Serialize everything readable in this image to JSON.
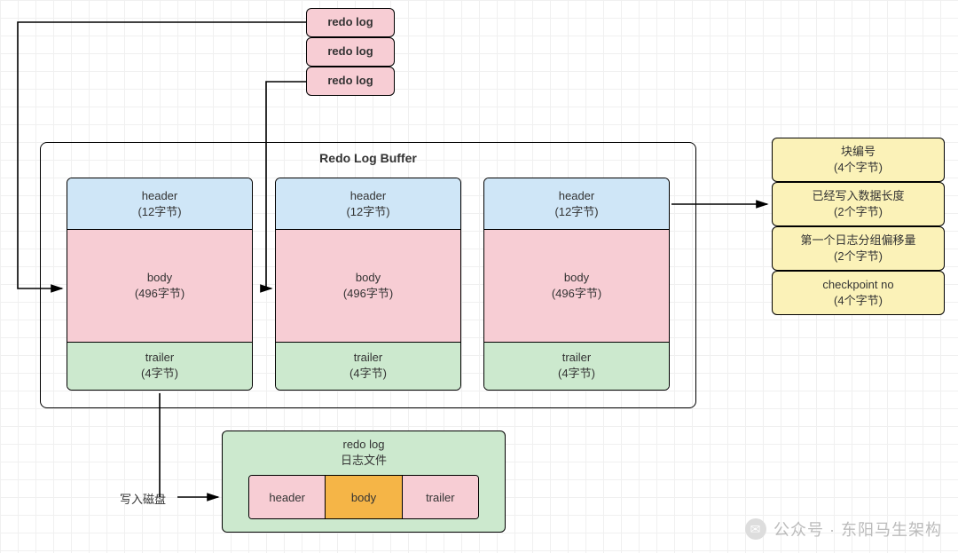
{
  "redoTop": [
    "redo log",
    "redo log",
    "redo log"
  ],
  "mainTitle": "Redo Log Buffer",
  "block": {
    "header": {
      "label": "header",
      "size": "(12字节)"
    },
    "body": {
      "label": "body",
      "size": "(496字节)"
    },
    "trailer": {
      "label": "trailer",
      "size": "(4字节)"
    }
  },
  "yellow": [
    {
      "l1": "块编号",
      "l2": "(4个字节)"
    },
    {
      "l1": "已经写入数据长度",
      "l2": "(2个字节)"
    },
    {
      "l1": "第一个日志分组偏移量",
      "l2": "(2个字节)"
    },
    {
      "l1": "checkpoint no",
      "l2": "(4个字节)"
    }
  ],
  "file": {
    "title1": "redo log",
    "title2": "日志文件",
    "cells": [
      "header",
      "body",
      "trailer"
    ]
  },
  "writeDisk": "写入磁盘",
  "watermark": "公众号 · 东阳马生架构"
}
